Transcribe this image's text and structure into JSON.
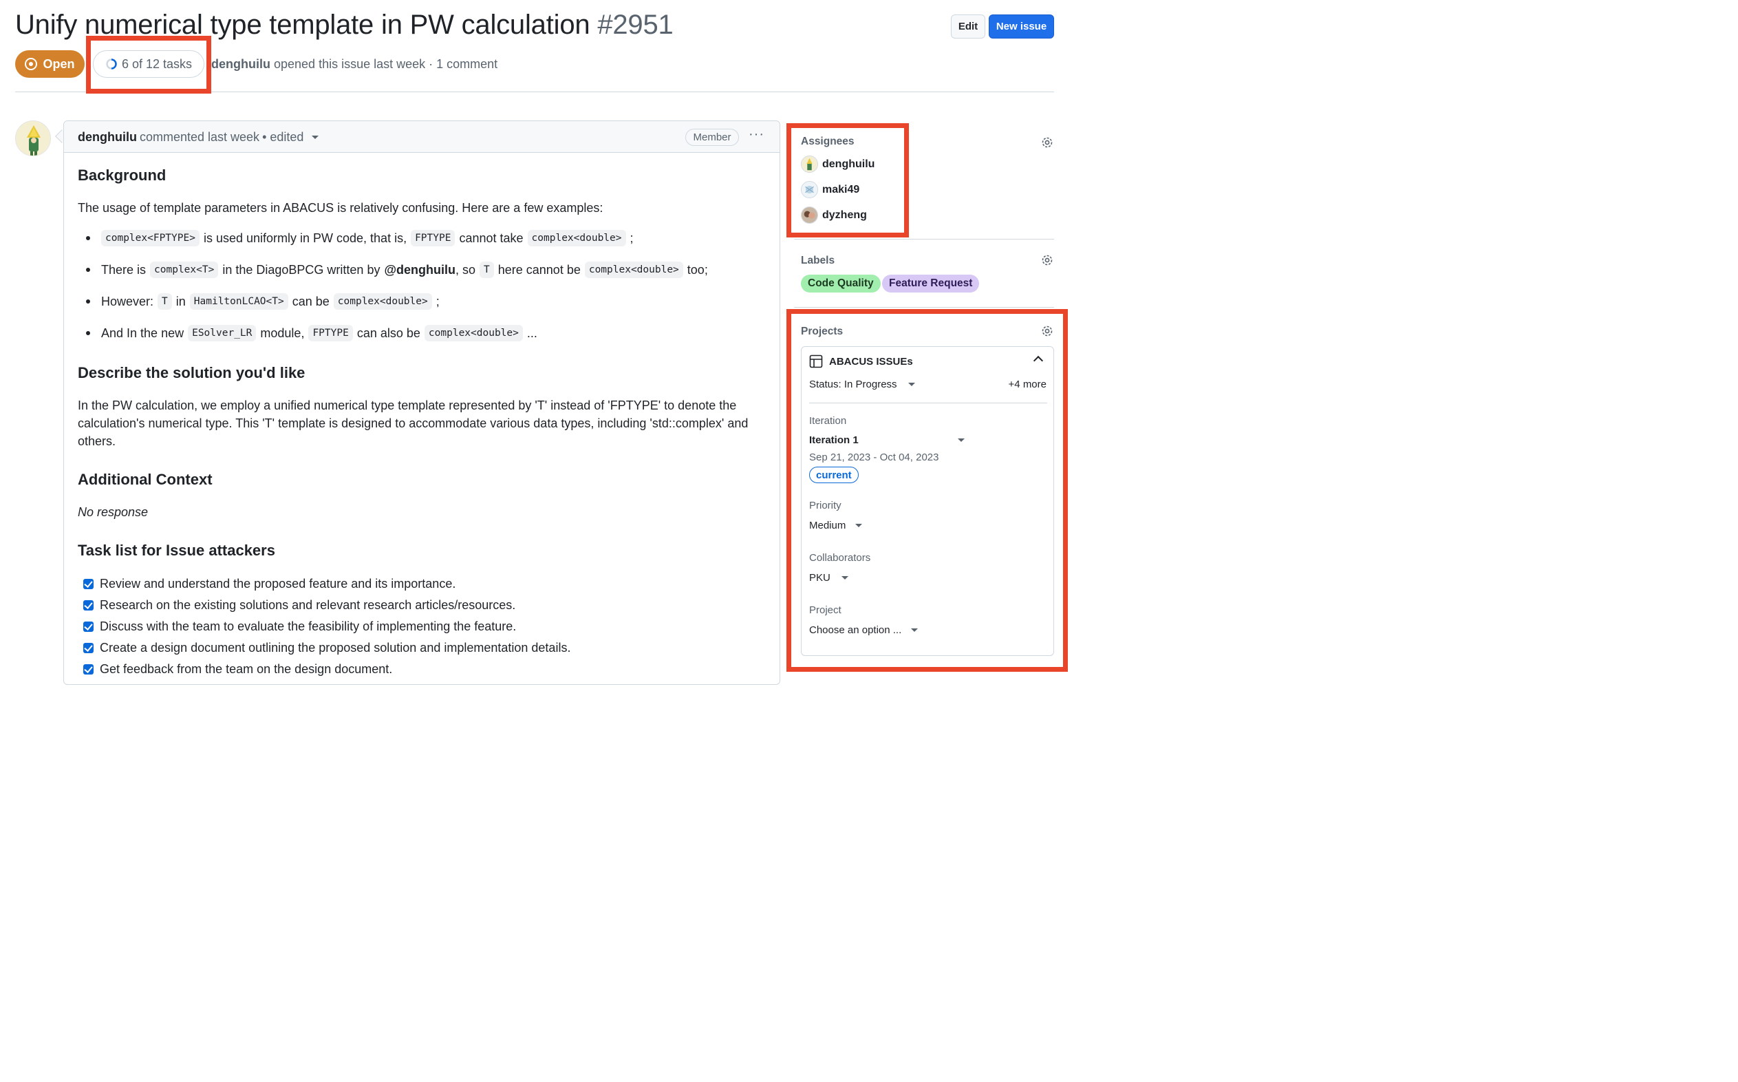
{
  "issue": {
    "title": "Unify numerical type template in PW calculation",
    "number": "#2951",
    "state": "Open",
    "tasks": "6 of 12 tasks",
    "author": "denghuilu",
    "opened_text": "opened this issue last week · 1 comment"
  },
  "header": {
    "edit_label": "Edit",
    "new_issue_label": "New issue"
  },
  "comment": {
    "author": "denghuilu",
    "meta": "commented last week",
    "edited": "• edited",
    "role": "Member",
    "more": "···"
  },
  "body": {
    "h_background": "Background",
    "p_intro": "The usage of template parameters in ABACUS is relatively confusing. Here are a few examples:",
    "li1": [
      "complex<FPTYPE>",
      "is used uniformly in PW code, that is,",
      "FPTYPE",
      "cannot take",
      "complex<double>",
      ";"
    ],
    "li2": [
      "There is",
      "complex<T>",
      "in the DiagoBPCG written by",
      "@denghuilu",
      ", so",
      "T",
      "here cannot be",
      "complex<double>",
      "too;"
    ],
    "li3": [
      "However:",
      "T",
      "in",
      "HamiltonLCAO<T>",
      "can be",
      "complex<double>",
      ";"
    ],
    "li4": [
      "And In the new",
      "ESolver_LR",
      "module,",
      "FPTYPE",
      "can also be",
      "complex<double>",
      "..."
    ],
    "h_solution": "Describe the solution you'd like",
    "p_solution": "In the PW calculation, we employ a unified numerical type template represented by 'T' instead of 'FPTYPE' to denote the calculation's numerical type. This 'T' template is designed to accommodate various data types, including 'std::complex' and others.",
    "h_context": "Additional Context",
    "p_context": "No response",
    "h_tasks": "Task list for Issue attackers",
    "tasks": [
      "Review and understand the proposed feature and its importance.",
      "Research on the existing solutions and relevant research articles/resources.",
      "Discuss with the team to evaluate the feasibility of implementing the feature.",
      "Create a design document outlining the proposed solution and implementation details.",
      "Get feedback from the team on the design document."
    ]
  },
  "sidebar": {
    "assignees_label": "Assignees",
    "assignees": [
      "denghuilu",
      "maki49",
      "dyzheng"
    ],
    "labels_label": "Labels",
    "labels": [
      {
        "name": "Code Quality",
        "bg": "#a2eeaf",
        "fg": "#1b3a20"
      },
      {
        "name": "Feature Request",
        "bg": "#d8c8f5",
        "fg": "#2f1d57"
      }
    ],
    "projects_label": "Projects",
    "project": {
      "name": "ABACUS ISSUEs",
      "status": "Status: In Progress",
      "more": "+4 more",
      "iteration_label": "Iteration",
      "iteration_value": "Iteration 1",
      "iteration_dates": "Sep 21, 2023 - Oct 04, 2023",
      "current": "current",
      "priority_label": "Priority",
      "priority_value": "Medium",
      "collab_label": "Collaborators",
      "collab_value": "PKU",
      "project_label": "Project",
      "project_value": "Choose an option ..."
    }
  },
  "colors": {
    "open": "#d3812b",
    "primary": "#1f6feb",
    "annotation": "#e8452a",
    "checkbox": "#0969da"
  }
}
